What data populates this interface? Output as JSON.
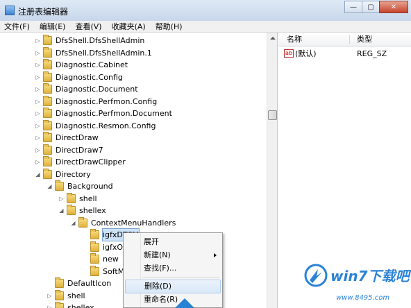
{
  "window": {
    "title": "注册表编辑器",
    "buttons": [
      "—",
      "▢",
      "✕"
    ]
  },
  "menu": [
    "文件(F)",
    "编辑(E)",
    "查看(V)",
    "收藏夹(A)",
    "帮助(H)"
  ],
  "tree": [
    {
      "label": "DfsShell.DfsShellAdmin",
      "indent": 0,
      "expander": "▷"
    },
    {
      "label": "DfsShell.DfsShellAdmin.1",
      "indent": 0,
      "expander": "▷"
    },
    {
      "label": "Diagnostic.Cabinet",
      "indent": 0,
      "expander": "▷"
    },
    {
      "label": "Diagnostic.Config",
      "indent": 0,
      "expander": "▷"
    },
    {
      "label": "Diagnostic.Document",
      "indent": 0,
      "expander": "▷"
    },
    {
      "label": "Diagnostic.Perfmon.Config",
      "indent": 0,
      "expander": "▷"
    },
    {
      "label": "Diagnostic.Perfmon.Document",
      "indent": 0,
      "expander": "▷"
    },
    {
      "label": "Diagnostic.Resmon.Config",
      "indent": 0,
      "expander": "▷"
    },
    {
      "label": "DirectDraw",
      "indent": 0,
      "expander": "▷"
    },
    {
      "label": "DirectDraw7",
      "indent": 0,
      "expander": "▷"
    },
    {
      "label": "DirectDrawClipper",
      "indent": 0,
      "expander": "▷"
    },
    {
      "label": "Directory",
      "indent": 0,
      "expander": "◢"
    },
    {
      "label": "Background",
      "indent": 1,
      "expander": "◢"
    },
    {
      "label": "shell",
      "indent": 2,
      "expander": "▷"
    },
    {
      "label": "shellex",
      "indent": 2,
      "expander": "◢"
    },
    {
      "label": "ContextMenuHandlers",
      "indent": 3,
      "expander": "◢"
    },
    {
      "label": "igfxDTCM",
      "indent": 4,
      "expander": "",
      "selected": true
    },
    {
      "label": "igfxOSP",
      "indent": 4,
      "expander": ""
    },
    {
      "label": "new",
      "indent": 4,
      "expander": ""
    },
    {
      "label": "SoftMgr",
      "indent": 4,
      "expander": ""
    },
    {
      "label": "DefaultIcon",
      "indent": 1,
      "expander": ""
    },
    {
      "label": "shell",
      "indent": 1,
      "expander": "▷"
    },
    {
      "label": "shellex",
      "indent": 1,
      "expander": "▷"
    }
  ],
  "list": {
    "col_name": "名称",
    "col_type": "类型",
    "rows": [
      {
        "icon": "ab",
        "name": "(默认)",
        "type": "REG_SZ"
      }
    ]
  },
  "context_menu": {
    "items": [
      {
        "label": "展开",
        "submenu": false
      },
      {
        "label": "新建(N)",
        "submenu": true
      },
      {
        "label": "查找(F)...",
        "submenu": false
      },
      {
        "label": "删除(D)",
        "submenu": false,
        "highlighted": true
      },
      {
        "label": "重命名(R)",
        "submenu": false
      }
    ]
  },
  "watermark": {
    "brand": "win7下载吧",
    "url": "www.8495.com"
  },
  "colors": {
    "accent": "#2a82d6",
    "selection": "#cde3f7"
  }
}
